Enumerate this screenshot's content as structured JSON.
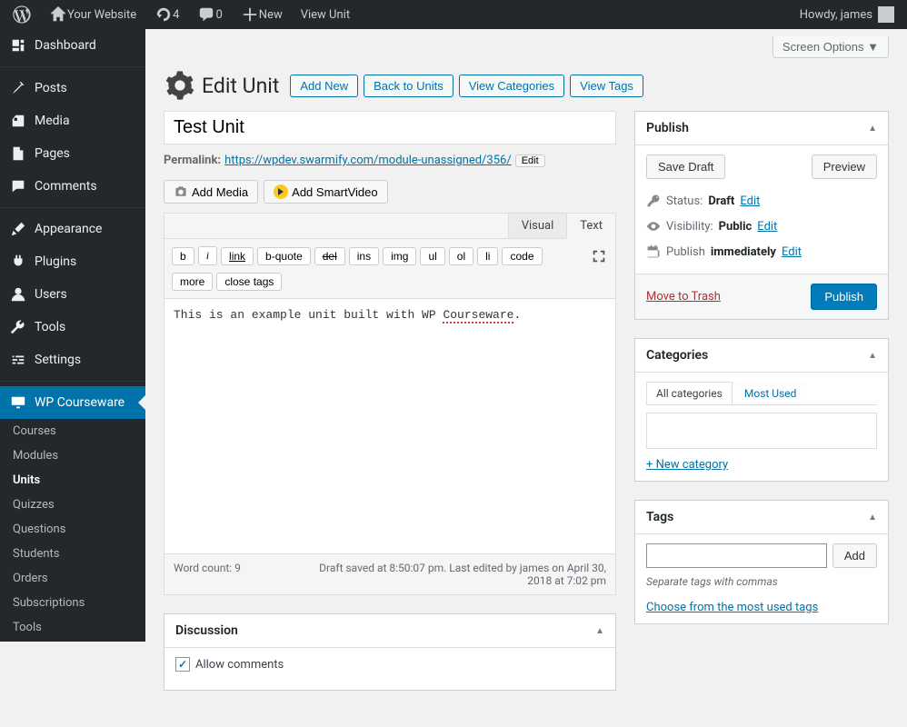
{
  "topbar": {
    "site_name": "Your Website",
    "updates_count": "4",
    "comments_count": "0",
    "new_label": "New",
    "view_label": "View Unit",
    "howdy": "Howdy, james"
  },
  "sidemenu": {
    "dashboard": "Dashboard",
    "posts": "Posts",
    "media": "Media",
    "pages": "Pages",
    "comments": "Comments",
    "appearance": "Appearance",
    "plugins": "Plugins",
    "users": "Users",
    "tools": "Tools",
    "settings": "Settings",
    "wp_courseware": "WP Courseware",
    "sub": {
      "courses": "Courses",
      "modules": "Modules",
      "units": "Units",
      "quizzes": "Quizzes",
      "questions": "Questions",
      "students": "Students",
      "orders": "Orders",
      "subscriptions": "Subscriptions",
      "tools": "Tools"
    }
  },
  "screen_options": "Screen Options ▼",
  "header": {
    "title": "Edit Unit",
    "add_new": "Add New",
    "back_to_units": "Back to Units",
    "view_categories": "View Categories",
    "view_tags": "View Tags"
  },
  "editor": {
    "title_value": "Test Unit",
    "permalink_label": "Permalink:",
    "permalink_url": "https://wpdev.swarmify.com/module-unassigned/356/",
    "permalink_edit": "Edit",
    "add_media": "Add Media",
    "add_smartvideo": "Add SmartVideo",
    "tabs": {
      "visual": "Visual",
      "text": "Text"
    },
    "quicktags": {
      "b": "b",
      "i": "i",
      "link": "link",
      "bquote": "b-quote",
      "del": "del",
      "ins": "ins",
      "img": "img",
      "ul": "ul",
      "ol": "ol",
      "li": "li",
      "code": "code",
      "more": "more",
      "close": "close tags"
    },
    "content_pre": "This is an example unit built with WP ",
    "content_spell": "Courseware",
    "content_post": ".",
    "word_count_label": "Word count: 9",
    "draft_info": "Draft saved at 8:50:07 pm. Last edited by james on April 30, 2018 at 7:02 pm"
  },
  "publish": {
    "title": "Publish",
    "save_draft": "Save Draft",
    "preview": "Preview",
    "status_label": "Status:",
    "status_value": "Draft",
    "visibility_label": "Visibility:",
    "visibility_value": "Public",
    "publish_label": "Publish",
    "publish_value": "immediately",
    "edit": "Edit",
    "move_to_trash": "Move to Trash",
    "publish_btn": "Publish"
  },
  "categories": {
    "title": "Categories",
    "all": "All categories",
    "most_used": "Most Used",
    "add_new": "+ New category"
  },
  "tags": {
    "title": "Tags",
    "add_btn": "Add",
    "hint": "Separate tags with commas",
    "choose": "Choose from the most used tags"
  },
  "discussion": {
    "title": "Discussion",
    "allow_comments": "Allow comments"
  }
}
